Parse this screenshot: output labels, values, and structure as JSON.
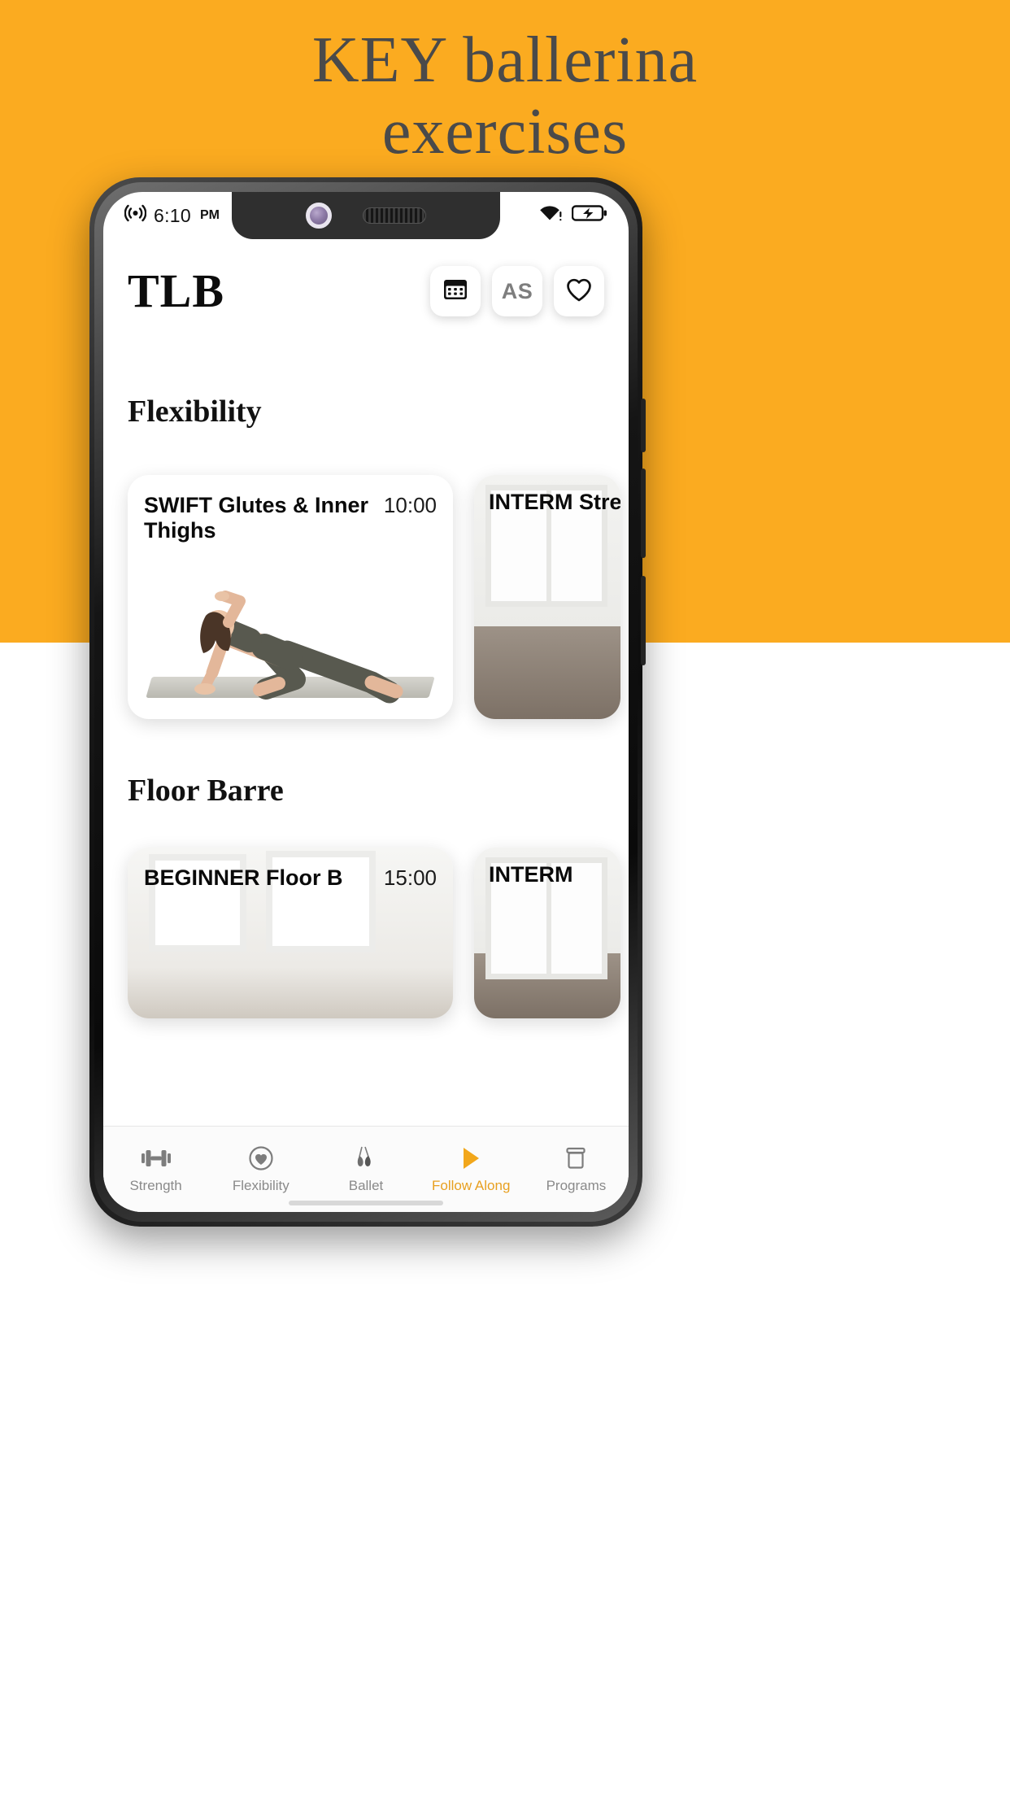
{
  "banner": {
    "title_line1": "KEY ballerina",
    "title_line2": "exercises",
    "background_color": "#FBAB20",
    "text_color": "#4a4a4a"
  },
  "status_bar": {
    "cast_icon": "broadcast-icon",
    "time": "6:10",
    "ampm": "PM",
    "wifi_icon": "wifi-icon",
    "battery_icon": "battery-charging-icon"
  },
  "header": {
    "logo": "TLB",
    "actions": [
      {
        "name": "calendar-button",
        "icon": "calendar-icon",
        "label": ""
      },
      {
        "name": "account-button",
        "icon": "text-badge",
        "label": "AS"
      },
      {
        "name": "favorites-button",
        "icon": "heart-icon",
        "label": ""
      }
    ]
  },
  "sections": [
    {
      "title": "Flexibility",
      "cards": [
        {
          "title": "SWIFT Glutes & Inner Thighs",
          "duration": "10:00",
          "type": "primary"
        },
        {
          "title": "INTERM Stretch",
          "duration": "",
          "type": "peek"
        }
      ]
    },
    {
      "title": "Floor Barre",
      "cards": [
        {
          "title": "BEGINNER Floor B",
          "duration": "15:00",
          "type": "primary"
        },
        {
          "title": "INTERM",
          "duration": "",
          "type": "peek"
        }
      ]
    }
  ],
  "bottom_nav": {
    "active_color": "#E8A020",
    "items": [
      {
        "label": "Strength",
        "icon": "dumbbell-icon",
        "active": false
      },
      {
        "label": "Flexibility",
        "icon": "heart-circle-icon",
        "active": false
      },
      {
        "label": "Ballet",
        "icon": "pointe-shoes-icon",
        "active": false
      },
      {
        "label": "Follow Along",
        "icon": "play-triangle-icon",
        "active": true
      },
      {
        "label": "Programs",
        "icon": "box-stack-icon",
        "active": false
      }
    ]
  }
}
